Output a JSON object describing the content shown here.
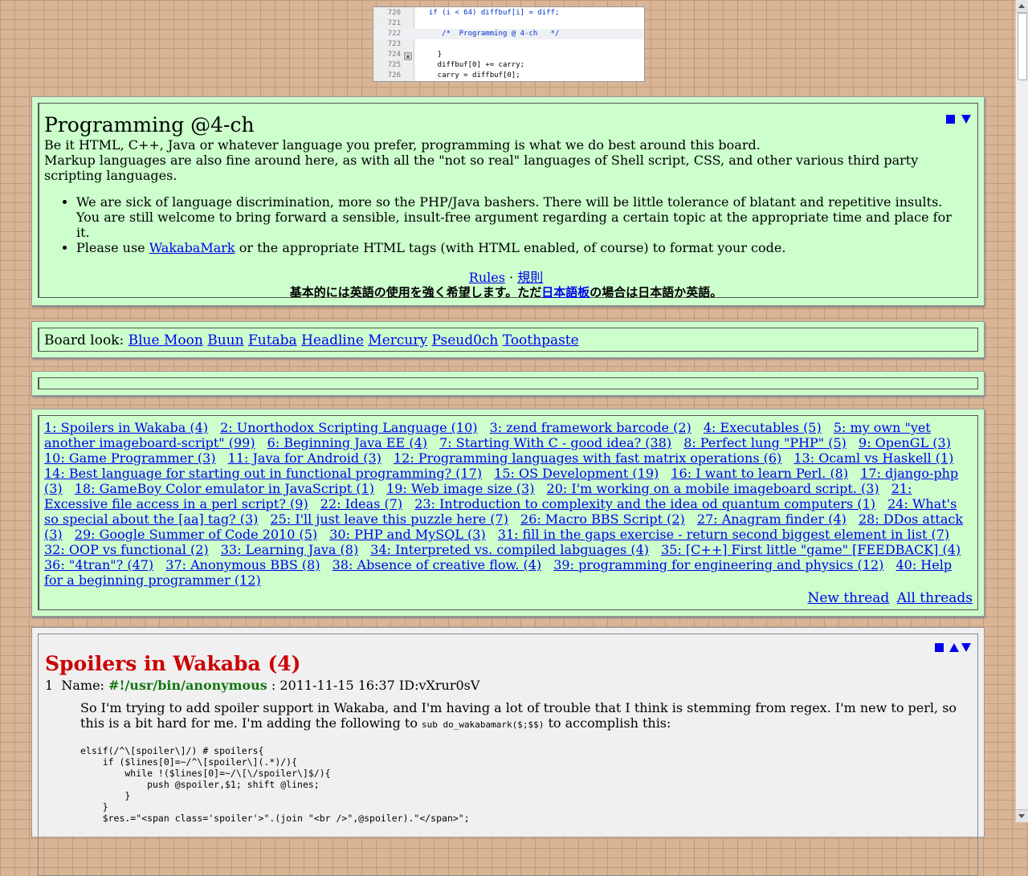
{
  "banner": {
    "lines": [
      {
        "num": "720",
        "code": "  if (i < 64) diffbuf[i] = diff;"
      },
      {
        "num": "721",
        "code": ""
      },
      {
        "num": "722",
        "code": "     /*  Programming @ 4-ch   */"
      },
      {
        "num": "723",
        "code": ""
      },
      {
        "num": "724",
        "code": "    }"
      },
      {
        "num": "725",
        "code": "    diffbuf[0] += carry;"
      },
      {
        "num": "726",
        "code": "    carry = diffbuf[0];"
      }
    ]
  },
  "board": {
    "title": "Programming @4-ch",
    "desc1": "Be it HTML, C++, Java or whatever language you prefer, programming is what we do best around this board.",
    "desc2": "Markup languages are also fine around here, as with all the \"not so real\" languages of Shell script, CSS, and other various third party scripting languages.",
    "rule1": "We are sick of language discrimination, more so the PHP/Java bashers. There will be little tolerance of blatant and repetitive insults. You are still welcome to bring forward a sensible, insult-free argument regarding a certain topic at the appropriate time and place for it.",
    "rule2_pre": "Please use ",
    "rule2_link": "WakabaMark",
    "rule2_post": " or the appropriate HTML tags (with HTML enabled, of course) to format your code.",
    "rules_link": "Rules",
    "rules_sep": " · ",
    "rules_jp_link": "規則",
    "jp_pre": "基本的には英語の使用を強く希望します。ただ",
    "jp_link": "日本語板",
    "jp_post": "の場合は日本語か英語。"
  },
  "look": {
    "label": "Board look:",
    "styles": [
      "Blue Moon",
      "Buun",
      "Futaba",
      "Headline",
      "Mercury",
      "Pseud0ch",
      "Toothpaste"
    ]
  },
  "threads": [
    "1: Spoilers in Wakaba (4)",
    "2: Unorthodox Scripting Language (10)",
    "3: zend framework barcode (2)",
    "4: Executables (5)",
    "5: my own \"yet another imageboard-script\" (99)",
    "6: Beginning Java EE (4)",
    "7: Starting With C - good idea? (38)",
    "8: Perfect lung \"PHP\" (5)",
    "9: OpenGL (3)",
    "10: Game Programmer (3)",
    "11: Java for Android (3)",
    "12: Programming languages with fast matrix operations (6)",
    "13: Ocaml vs Haskell (1)",
    "14: Best language for starting out in functional programming? (17)",
    "15: OS Development (19)",
    "16: I want to learn Perl. (8)",
    "17: django-php (3)",
    "18: GameBoy Color emulator in JavaScript (1)",
    "19: Web image size (3)",
    "20: I'm working on a mobile imageboard script. (3)",
    "21: Excessive file access in a perl script? (9)",
    "22: Ideas (7)",
    "23: Introduction to complexity and the idea od quantum computers (1)",
    "24: What's so special about the [aa] tag? (3)",
    "25: I'll just leave this puzzle here (7)",
    "26: Macro BBS Script (2)",
    "27: Anagram finder (4)",
    "28: DDos attack (3)",
    "29: Google Summer of Code 2010 (5)",
    "30: PHP and MySQL (3)",
    "31: fill in the gaps exercise - return second biggest element in list (7)",
    "32: OOP vs functional (2)",
    "33: Learning Java (8)",
    "34: Interpreted vs. compiled labguages (4)",
    "35: [C++] First little \"game\" [FEEDBACK] (4)",
    "36: \"4tran\"? (47)",
    "37: Anonymous BBS (8)",
    "38: Absence of creative flow. (4)",
    "39: programming for engineering and physics (12)",
    "40: Help for a beginning programmer (12)"
  ],
  "thread_actions": {
    "new": "New thread",
    "all": "All threads"
  },
  "post": {
    "title": "Spoilers in Wakaba (4)",
    "num": "1",
    "name_label": "Name:",
    "name": "#!/usr/bin/anonymous",
    "meta": ": 2011-11-15 16:37 ID:vXrur0sV",
    "body_pre": "So I'm trying to add spoiler support in Wakaba, and I'm having a lot of trouble that I think is stemming from regex. I'm new to perl, so this is a bit hard for me. I'm adding the following to ",
    "body_code": "sub do_wakabamark($;$$)",
    "body_post": " to accomplish this:",
    "code": "elsif(/^\\[spoiler\\]/) # spoilers{\n    if ($lines[0]=~/^\\[spoiler\\](.*)/){\n        while !($lines[0]=~/\\[\\/spoiler\\]$/){\n            push @spoiler,$1; shift @lines;\n        }\n    }\n    $res.=\"<span class='spoiler'>\".(join \"<br />\",@spoiler).\"</span>\";"
  },
  "colors": {
    "board_bg": "#ccffcc",
    "link": "#0000ee",
    "post_title": "#cc0000",
    "poster_name": "#117711"
  }
}
